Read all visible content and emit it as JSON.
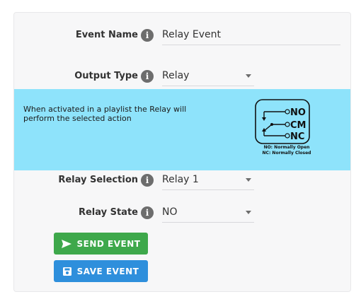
{
  "form": {
    "event_name": {
      "label": "Event Name",
      "value": "Relay Event",
      "icon": "info-icon"
    },
    "output_type": {
      "label": "Output Type",
      "value": "Relay",
      "icon": "info-icon"
    },
    "relay_selection": {
      "label": "Relay Selection",
      "value": "Relay 1",
      "icon": "info-icon"
    },
    "relay_state": {
      "label": "Relay State",
      "value": "NO",
      "icon": "info-icon"
    }
  },
  "banner": {
    "text": "When activated in a playlist the Relay will perform the selected action",
    "background": "#8ee3fb",
    "diagram": {
      "no_label": "NO",
      "cm_label": "CM",
      "nc_label": "NC",
      "legend_no": "NO: Normally Open",
      "legend_nc": "NC: Normally Closed"
    }
  },
  "buttons": {
    "send_label": "SEND EVENT",
    "save_label": "SAVE EVENT",
    "send_color": "#3ea84b",
    "save_color": "#2e8fdc",
    "send_icon": "send-icon",
    "save_icon": "save-icon"
  },
  "info_glyph": "i"
}
